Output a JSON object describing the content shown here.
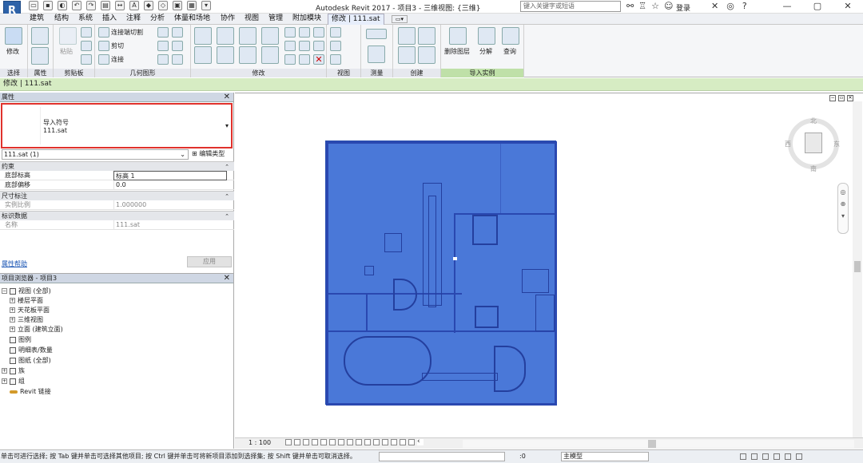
{
  "titlebar": {
    "app_button": "R",
    "title": "Autodesk Revit 2017 -   项目3 - 三维视图: {三维}",
    "search_placeholder": "键入关键字或短语",
    "login": "登录"
  },
  "ribbon_tabs": [
    "建筑",
    "结构",
    "系统",
    "插入",
    "注释",
    "分析",
    "体量和场地",
    "协作",
    "视图",
    "管理",
    "附加模块",
    "修改 | 111.sat"
  ],
  "ribbon": {
    "select": {
      "modify_label": "修改",
      "group": "选择"
    },
    "properties_group": "属性",
    "clipboard": {
      "paste_label": "粘贴",
      "group": "剪贴板"
    },
    "geometry": {
      "join_cut_label": "连接端切割",
      "cut_label": "剪切",
      "join_label": "连接",
      "group": "几何图形"
    },
    "modify_group": "修改",
    "view_group": "视图",
    "measure_group": "测量",
    "create_group": "创建",
    "import_instance": {
      "delete_layers_label": "删除图层",
      "explode_label": "分解",
      "query_label": "查询",
      "group": "导入实例"
    }
  },
  "context_bar": "修改 | 111.sat",
  "properties": {
    "header": "属性",
    "type_category": "导入符号",
    "type_name": "111.sat",
    "instance_selector": "111.sat (1)",
    "edit_type": "编辑类型",
    "sections": [
      {
        "title": "约束",
        "rows": [
          {
            "key": "底部标高",
            "value": "标高 1"
          },
          {
            "key": "底部偏移",
            "value": "0.0"
          }
        ]
      },
      {
        "title": "尺寸标注",
        "rows": [
          {
            "key": "实例比例",
            "value": "1.000000"
          }
        ]
      },
      {
        "title": "标识数据",
        "rows": [
          {
            "key": "名称",
            "value": "111.sat"
          }
        ]
      }
    ],
    "help_link": "属性帮助",
    "apply_button": "应用"
  },
  "browser": {
    "header": "项目浏览器 - 项目3",
    "items": [
      "视图 (全部)",
      "楼层平面",
      "天花板平面",
      "三维视图",
      "立面 (建筑立面)",
      "图例",
      "明细表/数量",
      "图纸 (全部)",
      "族",
      "组",
      "Revit 链接"
    ]
  },
  "viewcube": {
    "north": "北",
    "south": "南",
    "east": "东",
    "west": "西"
  },
  "view_bar": {
    "scale": "1 : 100"
  },
  "status": {
    "message": "单击可进行选择; 按 Tab 键并单击可选择其他项目; 按 Ctrl 键并单击可将新项目添加到选择集; 按 Shift 键并单击可取消选择。",
    "zero": ":0",
    "model": "主模型"
  },
  "colors": {
    "selection_blue": "#4a78d8",
    "highlight_red": "#e0322c",
    "context_green": "#d6ecc3"
  }
}
